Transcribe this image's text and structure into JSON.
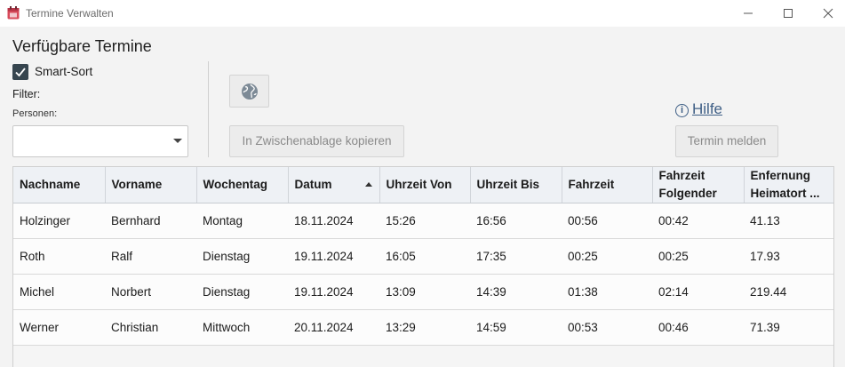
{
  "window": {
    "title": "Termine Verwalten"
  },
  "panel": {
    "heading": "Verfügbare Termine",
    "smart_sort_label": "Smart-Sort",
    "smart_sort_checked": true,
    "filter_label": "Filter:",
    "persons_label": "Personen:",
    "persons_value": ""
  },
  "toolbar": {
    "copy_label": "In Zwischenablage kopieren",
    "help_label": "Hilfe",
    "report_label": "Termin melden",
    "globe_icon": "globe-icon",
    "help_icon": "info-icon"
  },
  "table": {
    "headers": [
      "Nachname",
      "Vorname",
      "Wochentag",
      "Datum",
      "Uhrzeit Von",
      "Uhrzeit Bis",
      "Fahrzeit",
      "Fahrzeit Folgender",
      "Enfernung Heimatort ..."
    ],
    "sort_column": "Datum",
    "sort_direction": "ascending",
    "rows": [
      [
        "Holzinger",
        "Bernhard",
        "Montag",
        "18.11.2024",
        "15:26",
        "16:56",
        "00:56",
        "00:42",
        "41.13"
      ],
      [
        "Roth",
        "Ralf",
        "Dienstag",
        "19.11.2024",
        "16:05",
        "17:35",
        "00:25",
        "00:25",
        "17.93"
      ],
      [
        "Michel",
        "Norbert",
        "Dienstag",
        "19.11.2024",
        "13:09",
        "14:39",
        "01:38",
        "02:14",
        "219.44"
      ],
      [
        "Werner",
        "Christian",
        "Mittwoch",
        "20.11.2024",
        "13:29",
        "14:59",
        "00:53",
        "00:46",
        "71.39"
      ]
    ]
  },
  "colors": {
    "accent": "#36454f",
    "link": "#3f5f86",
    "app_icon": "#d84a5a"
  }
}
